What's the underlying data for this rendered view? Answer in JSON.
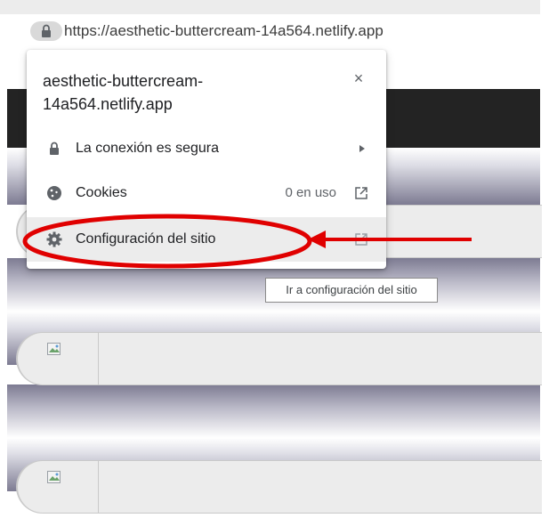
{
  "browser": {
    "url": "https://aesthetic-buttercream-14a564.netlify.app"
  },
  "site_info": {
    "title": "aesthetic-buttercream-14a564.netlify.app",
    "close_symbol": "×",
    "connection_label": "La conexión es segura",
    "cookies_label": "Cookies",
    "cookies_count": "0 en uso",
    "site_settings_label": "Configuración del sitio"
  },
  "tooltip": {
    "text": "Ir a configuración del sitio"
  },
  "annotation": {
    "color": "#e00000"
  },
  "icons": {
    "lock": "lock-icon",
    "cookie": "cookie-icon",
    "gear": "gear-icon",
    "chevron": "chevron-right-icon",
    "external": "external-link-icon",
    "broken_image": "broken-image-icon"
  }
}
